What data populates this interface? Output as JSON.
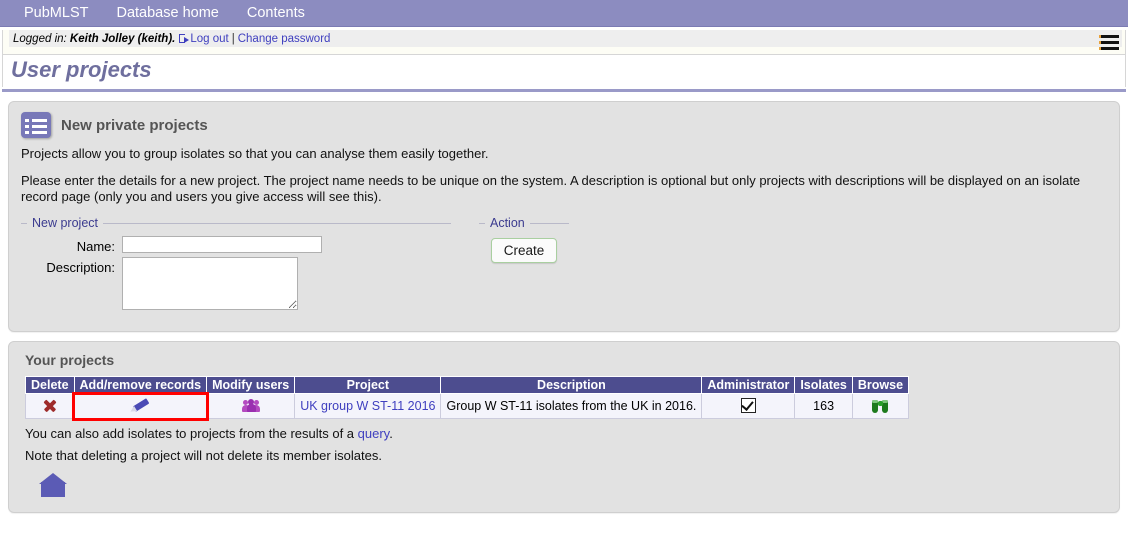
{
  "nav": {
    "items": [
      {
        "label": "PubMLST"
      },
      {
        "label": "Database home"
      },
      {
        "label": "Contents"
      }
    ]
  },
  "login_bar": {
    "prefix": "Logged in:",
    "user": "Keith Jolley (keith).",
    "logout_label": "Log out",
    "separator": "|",
    "change_password_label": "Change password",
    "menu_icon": "hamburger-icon"
  },
  "page": {
    "title": "User projects"
  },
  "new_projects_panel": {
    "icon": "list-icon",
    "heading": "New private projects",
    "paragraph1": "Projects allow you to group isolates so that you can analyse them easily together.",
    "paragraph2": "Please enter the details for a new project. The project name needs to be unique on the system. A description is optional but only projects with descriptions will be displayed on an isolate record page (only you and users you give access will see this).",
    "fieldset_new_project_legend": "New project",
    "fieldset_action_legend": "Action",
    "name_label": "Name:",
    "name_value": "",
    "name_placeholder": "",
    "description_label": "Description:",
    "description_value": "",
    "description_placeholder": "",
    "create_button_label": "Create"
  },
  "your_projects_panel": {
    "heading": "Your projects",
    "table": {
      "columns": [
        "Delete",
        "Add/remove records",
        "Modify users",
        "Project",
        "Description",
        "Administrator",
        "Isolates",
        "Browse"
      ],
      "rows": [
        {
          "delete_icon": "red-x-icon",
          "add_remove_icon": "pencil-icon",
          "modify_users_icon": "users-icon",
          "project": "UK group W ST-11 2016",
          "description": "Group W ST-11 isolates from the UK in 2016.",
          "administrator": "checked",
          "isolates": "163",
          "browse_icon": "binoculars-icon",
          "highlighted_cell": "add_remove_records"
        }
      ]
    },
    "footnote1_before": "You can also add isolates to projects from the results of a ",
    "footnote1_link": "query",
    "footnote1_after": ".",
    "footnote2": "Note that deleting a project will not delete its member isolates.",
    "home_icon": "home-icon"
  },
  "colors": {
    "nav_background": "#8c8cc0",
    "title_text": "#6f6f9e",
    "panel_background": "#e2e2e2",
    "table_header": "#4d4d8f",
    "link": "#3f3fbf",
    "highlight_box": "#ff0000",
    "create_border": "#a9cfa0"
  }
}
